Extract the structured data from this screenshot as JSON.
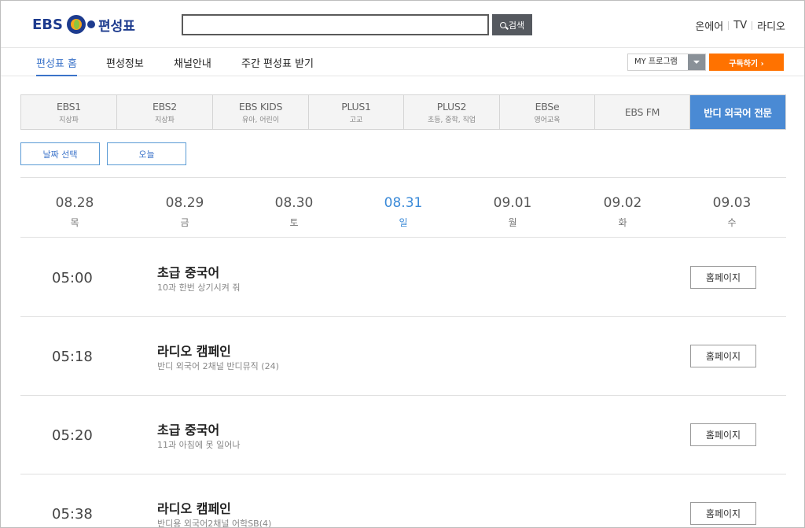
{
  "header": {
    "logo_text": "EBS",
    "logo_sub": "편성표",
    "search_placeholder": "",
    "search_button": "검색",
    "links": [
      "온에어",
      "TV",
      "라디오"
    ]
  },
  "nav": {
    "items": [
      "편성표 홈",
      "편성정보",
      "채널안내",
      "주간 편성표 받기"
    ],
    "active_index": 0,
    "my_program": "MY 프로그램",
    "subscribe": "구독하기 ›"
  },
  "channels": [
    {
      "name": "EBS1",
      "sub": "지상파"
    },
    {
      "name": "EBS2",
      "sub": "지상파"
    },
    {
      "name": "EBS KIDS",
      "sub": "유아, 어린이"
    },
    {
      "name": "PLUS1",
      "sub": "고교"
    },
    {
      "name": "PLUS2",
      "sub": "초등, 중학, 직업"
    },
    {
      "name": "EBSe",
      "sub": "영어교육"
    },
    {
      "name": "EBS FM",
      "sub": ""
    },
    {
      "name": "반디 외국어 전문",
      "sub": ""
    }
  ],
  "active_channel_index": 7,
  "date_controls": {
    "select": "날짜 선택",
    "today": "오늘"
  },
  "days": [
    {
      "date": "08.28",
      "weekday": "목"
    },
    {
      "date": "08.29",
      "weekday": "금"
    },
    {
      "date": "08.30",
      "weekday": "토"
    },
    {
      "date": "08.31",
      "weekday": "일"
    },
    {
      "date": "09.01",
      "weekday": "월"
    },
    {
      "date": "09.02",
      "weekday": "화"
    },
    {
      "date": "09.03",
      "weekday": "수"
    }
  ],
  "active_day_index": 3,
  "programs": [
    {
      "time": "05:00",
      "title": "초급 중국어",
      "subtitle": "10과 한번 상기시켜 줘",
      "button": "홈페이지"
    },
    {
      "time": "05:18",
      "title": "라디오 캠페인",
      "subtitle": "반디 외국어 2채널 반디뮤직 (24)",
      "button": "홈페이지"
    },
    {
      "time": "05:20",
      "title": "초급 중국어",
      "subtitle": "11과 아침에 못 일어나",
      "button": "홈페이지"
    },
    {
      "time": "05:38",
      "title": "라디오 캠페인",
      "subtitle": "반디용 외국어2채널 어학SB(4)",
      "button": "홈페이지"
    }
  ],
  "colors": {
    "accent": "#4a8ad4",
    "subscribe": "#ff7200",
    "brand": "#1d3b8e"
  }
}
